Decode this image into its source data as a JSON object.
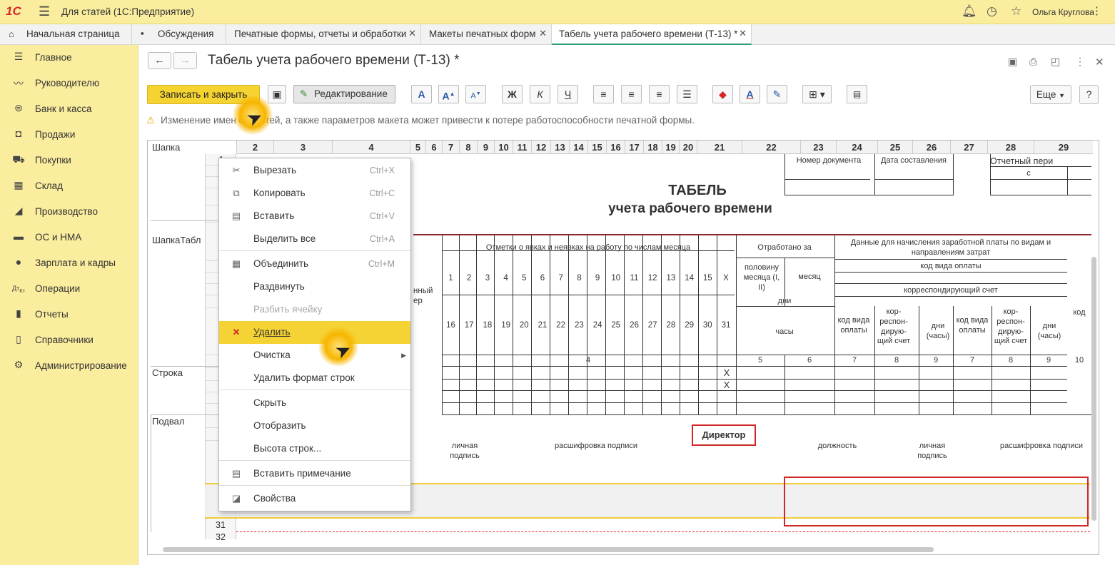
{
  "app": {
    "title": "Для статей (1С:Предприятие)",
    "logo": "1С",
    "user": "Ольга Круглова"
  },
  "tabs": [
    {
      "label": "Начальная страница",
      "icon": "home-icon"
    },
    {
      "label": "Обсуждения",
      "icon": "chat-icon"
    },
    {
      "label": "Печатные формы, отчеты и обработки"
    },
    {
      "label": "Макеты печатных форм"
    },
    {
      "label": "Табель учета рабочего времени (Т-13) *"
    }
  ],
  "sidebar": {
    "items": [
      {
        "label": "Главное",
        "icon": "menu-lines-icon"
      },
      {
        "label": "Руководителю",
        "icon": "trend-icon"
      },
      {
        "label": "Банк и касса",
        "icon": "coin-icon"
      },
      {
        "label": "Продажи",
        "icon": "bag-icon"
      },
      {
        "label": "Покупки",
        "icon": "cart-icon"
      },
      {
        "label": "Склад",
        "icon": "warehouse-icon"
      },
      {
        "label": "Производство",
        "icon": "factory-icon"
      },
      {
        "label": "ОС и НМА",
        "icon": "truck-icon"
      },
      {
        "label": "Зарплата и кадры",
        "icon": "person-icon"
      },
      {
        "label": "Операции",
        "icon": "dt-kt-icon"
      },
      {
        "label": "Отчеты",
        "icon": "bar-chart-icon"
      },
      {
        "label": "Справочники",
        "icon": "book-icon"
      },
      {
        "label": "Администрирование",
        "icon": "gear-icon"
      }
    ]
  },
  "document": {
    "title": "Табель учета рабочего времени (Т-13) *"
  },
  "toolbar": {
    "save_close": "Записать и закрыть",
    "edit_mode": "Редактирование",
    "more": "Еще",
    "help": "?",
    "format_buttons": [
      "A",
      "A",
      "A",
      "Ж",
      "К",
      "Ч"
    ]
  },
  "warning": "Изменение имен областей, а также параметров макета может привести к потере работоспособности печатной формы.",
  "sheet": {
    "col_headers": [
      "2",
      "3",
      "4",
      "5",
      "6",
      "7",
      "8",
      "9",
      "10",
      "11",
      "12",
      "13",
      "14",
      "15",
      "16",
      "17",
      "18",
      "19",
      "20",
      "21",
      "22",
      "23",
      "24",
      "25",
      "26",
      "27",
      "28",
      "29"
    ],
    "row_headers": [
      "1",
      "1",
      "1",
      "1",
      "1",
      "1",
      "1",
      "1",
      "2",
      "2",
      "2",
      "2",
      "2",
      "2",
      "2",
      "2",
      "2",
      "3",
      "31",
      "32"
    ],
    "groups": [
      "Шапка",
      "ШапкаТабл",
      "Строка",
      "Подвал"
    ],
    "texts": {
      "tabel": "ТАБЕЛЬ",
      "tabel_sub": "учета  рабочего времени",
      "doc_number": "Номер документа",
      "doc_date": "Дата составления",
      "period": "Отчетный пери",
      "period_from": "с",
      "marks": "Отметки о явках и неявках на работу по числам месяца",
      "worked": "Отработано за",
      "half_month": "половину месяца (I, II)",
      "month": "месяц",
      "days": "дни",
      "hours": "часы",
      "payroll": "Данные для начисления заработной платы по видам и направлениям затрат",
      "pay_code": "код вида оплаты",
      "corr_account": "корреспондирующий счет",
      "code_kind": "код вида оплаты",
      "corr_acc2": "кор-респон-дирую-щий счет",
      "days_hours": "дни (часы)",
      "code": "код",
      "tab_num": "нный ер",
      "director": "Директор",
      "personal_sign": "личная подпись",
      "sign_decode": "расшифровка подписи",
      "position": "должность"
    },
    "days_row1": [
      "1",
      "2",
      "3",
      "4",
      "5",
      "6",
      "7",
      "8",
      "9",
      "10",
      "11",
      "12",
      "13",
      "14",
      "15",
      "X"
    ],
    "days_row2": [
      "16",
      "17",
      "18",
      "19",
      "20",
      "21",
      "22",
      "23",
      "24",
      "25",
      "26",
      "27",
      "28",
      "29",
      "30",
      "31"
    ],
    "num_row": [
      "4",
      "5",
      "6",
      "7",
      "8",
      "9",
      "7",
      "8",
      "9",
      "10"
    ],
    "x_marks": [
      "X",
      "X"
    ]
  },
  "context_menu": {
    "items": [
      {
        "label": "Вырезать",
        "shortcut": "Ctrl+X",
        "icon": "scissors-icon"
      },
      {
        "label": "Копировать",
        "shortcut": "Ctrl+C",
        "icon": "copy-icon"
      },
      {
        "label": "Вставить",
        "shortcut": "Ctrl+V",
        "icon": "paste-icon"
      },
      {
        "label": "Выделить все",
        "shortcut": "Ctrl+A"
      },
      {
        "label": "Объединить",
        "shortcut": "Ctrl+M",
        "icon": "merge-icon"
      },
      {
        "label": "Раздвинуть"
      },
      {
        "label": "Разбить ячейку",
        "disabled": true
      },
      {
        "label": "Удалить",
        "icon": "delete-icon",
        "selected": true
      },
      {
        "label": "Очистка",
        "submenu": true
      },
      {
        "label": "Удалить формат строк"
      },
      {
        "label": "Скрыть"
      },
      {
        "label": "Отобразить"
      },
      {
        "label": "Высота строк..."
      },
      {
        "label": "Вставить примечание",
        "icon": "note-icon"
      },
      {
        "label": "Свойства",
        "icon": "properties-icon"
      }
    ]
  },
  "colors": {
    "title_bar": "#fbed9e",
    "accent": "#f5d432",
    "selection": "#f6d335",
    "red": "#d32626",
    "teal": "#2e9c7a"
  }
}
